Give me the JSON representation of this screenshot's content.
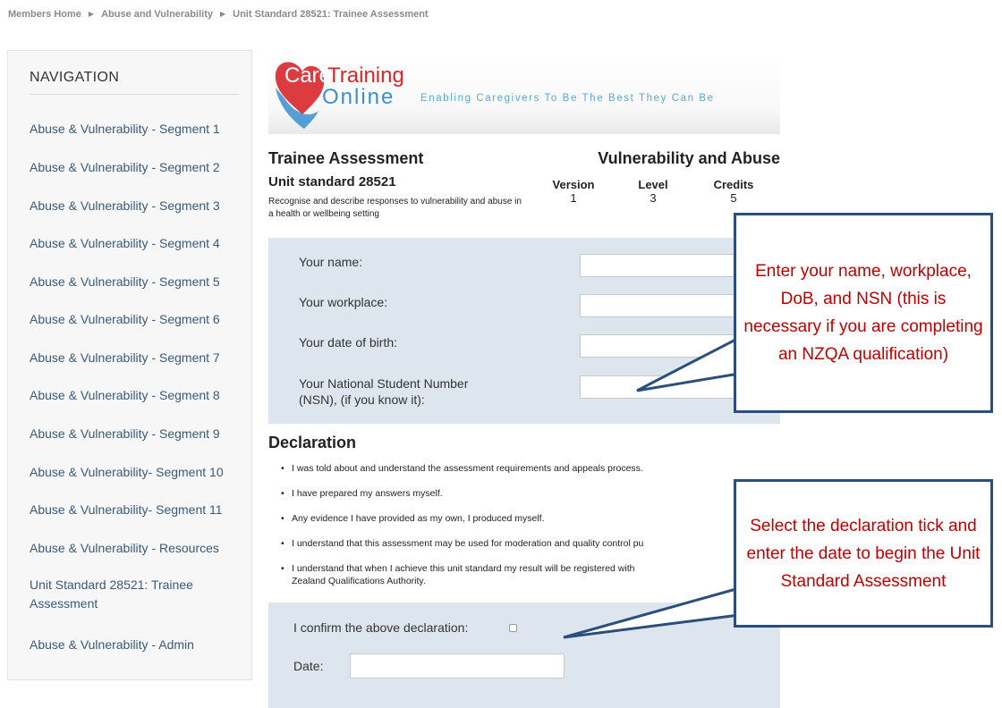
{
  "breadcrumb": {
    "items": [
      "Members Home",
      "Abuse and Vulnerability",
      "Unit Standard 28521: Trainee Assessment"
    ],
    "separator": "▶"
  },
  "navigation": {
    "title": "NAVIGATION",
    "items": [
      "Abuse & Vulnerability - Segment 1",
      "Abuse & Vulnerability - Segment 2",
      "Abuse & Vulnerability - Segment 3",
      "Abuse & Vulnerability - Segment 4",
      "Abuse & Vulnerability - Segment 5",
      "Abuse & Vulnerability - Segment 6",
      "Abuse & Vulnerability - Segment 7",
      "Abuse & Vulnerability - Segment 8",
      "Abuse & Vulnerability - Segment 9",
      "Abuse & Vulnerability- Segment 10",
      "Abuse & Vulnerability- Segment 11",
      "Abuse & Vulnerability - Resources",
      "Unit Standard 28521: Trainee Assessment",
      "Abuse & Vulnerability - Admin"
    ]
  },
  "logo": {
    "care": "Care",
    "training": "Training",
    "online": "Online",
    "tagline": "Enabling Caregivers To Be The Best They Can Be"
  },
  "assessment": {
    "title": "Trainee Assessment",
    "subject": "Vulnerability and Abuse",
    "unit_standard": "Unit standard 28521",
    "description": "Recognise and describe responses to vulnerability and abuse in a health or wellbeing setting",
    "version_label": "Version",
    "version_value": "1",
    "level_label": "Level",
    "level_value": "3",
    "credits_label": "Credits",
    "credits_value": "5"
  },
  "form": {
    "name_label": "Your name:",
    "workplace_label": "Your workplace:",
    "dob_label": "Your date of birth:",
    "nsn_label_line1": "Your National Student Number",
    "nsn_label_line2": "(NSN), (if you know it):",
    "name_value": "",
    "workplace_value": "",
    "dob_value": "",
    "nsn_value": ""
  },
  "declaration": {
    "title": "Declaration",
    "items": [
      "I was told about and understand the assessment requirements and appeals process.",
      "I have prepared my answers myself.",
      "Any evidence I have provided as my own, I produced myself.",
      "I understand that this assessment may be used for moderation and quality control pu",
      "I understand that when I achieve this unit standard my result will be registered with"
    ],
    "item5_line2": "Zealand Qualifications Authority.",
    "confirm_label": "I confirm the above declaration:",
    "confirm_checked": false,
    "date_label": "Date:",
    "date_value": ""
  },
  "callouts": {
    "top": "Enter your name, workplace, DoB, and NSN (this is necessary if you are completing an NZQA qualification)",
    "bottom": "Select the declaration tick and enter the date to begin the Unit Standard Assessment"
  },
  "colors": {
    "callout_border": "#2b4e7d",
    "callout_text": "#c00000",
    "form_bg": "#dde6ee",
    "logo_red": "#d8262b",
    "logo_blue": "#3a8fd0"
  }
}
